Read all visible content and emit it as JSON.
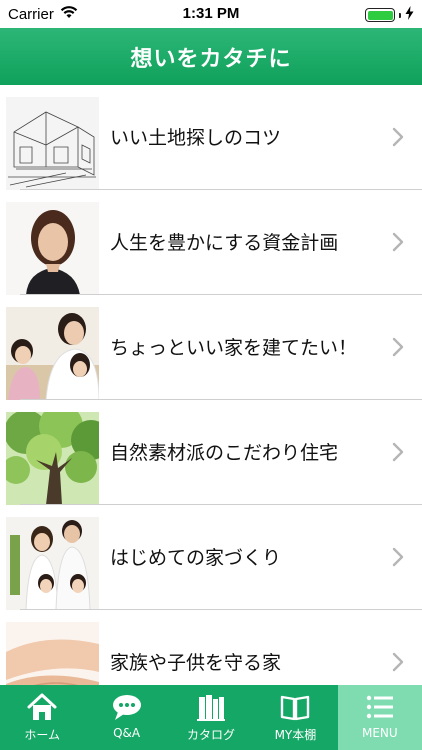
{
  "status_bar": {
    "carrier": "Carrier",
    "time": "1:31 PM",
    "wifi_icon": "wifi-icon",
    "battery_icon": "battery-icon",
    "charging_icon": "charging-bolt-icon"
  },
  "nav": {
    "title": "想いをカタチに"
  },
  "list": {
    "items": [
      {
        "label": "いい土地探しのコツ",
        "image": "house-sketch-image"
      },
      {
        "label": "人生を豊かにする資金計画",
        "image": "woman-portrait-image"
      },
      {
        "label": "ちょっといい家を建てたい！",
        "image": "family-kitchen-image"
      },
      {
        "label": "自然素材派のこだわり住宅",
        "image": "tree-canopy-image"
      },
      {
        "label": "はじめての家づくり",
        "image": "family-portrait-image"
      },
      {
        "label": "家族や子供を守る家",
        "image": "hands-image"
      }
    ]
  },
  "tab_bar": {
    "tabs": [
      {
        "label": "ホーム",
        "icon": "home-icon"
      },
      {
        "label": "Q&A",
        "icon": "speech-bubble-icon"
      },
      {
        "label": "カタログ",
        "icon": "books-icon"
      },
      {
        "label": "MY本棚",
        "icon": "open-book-icon"
      },
      {
        "label": "MENU",
        "icon": "menu-list-icon"
      }
    ],
    "active": "MENU"
  },
  "colors": {
    "accent": "#14a765",
    "active_tab": "#7fdcb0",
    "chevron": "#b5b5b5"
  }
}
